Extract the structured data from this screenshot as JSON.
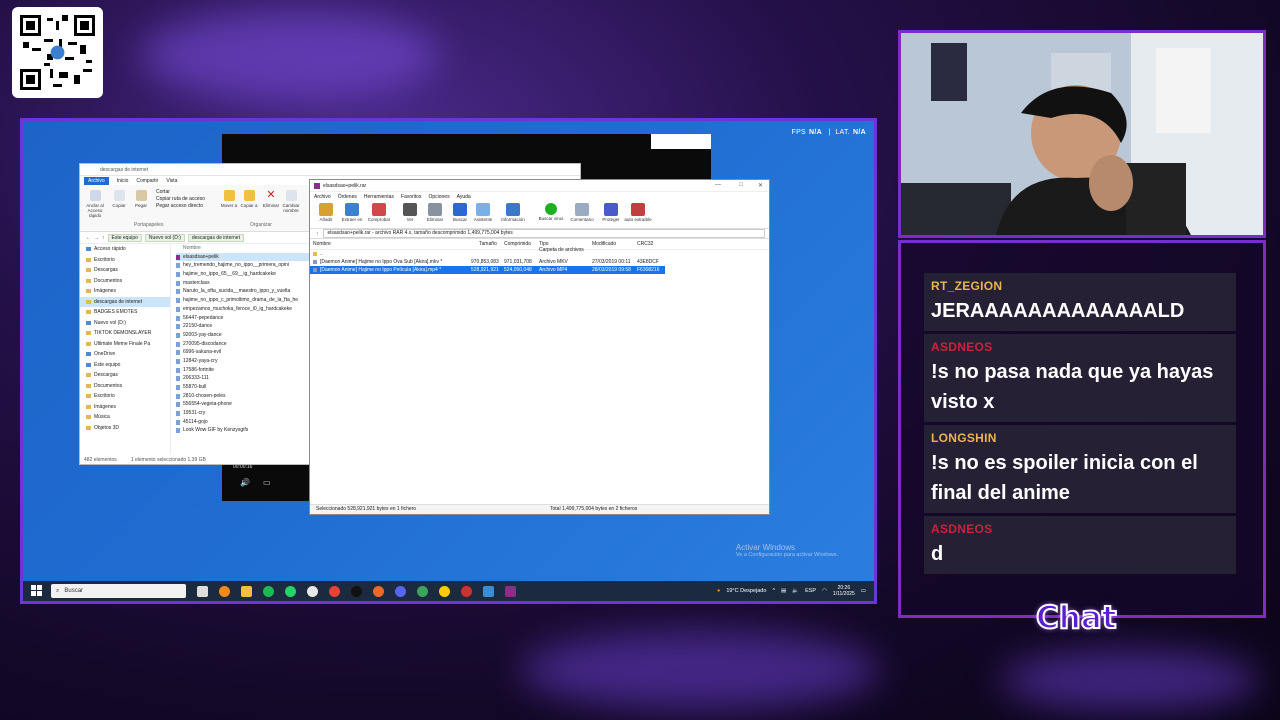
{
  "colors": {
    "accent": "#7a2ec8",
    "selection": "#1a73e8",
    "username_1": "#e8b64a",
    "username_2": "#c8243c"
  },
  "overlay": {
    "fps": {
      "label": "FPS",
      "value": "N/A"
    },
    "lat": {
      "label": "LAT.",
      "value": "N/A"
    },
    "chat_label": "Chat"
  },
  "explorer": {
    "title": "descargas de internet",
    "tabs": [
      "Archivo",
      "Inicio",
      "Compartir",
      "Vista"
    ],
    "ribbon": {
      "pin": "Anclar al Acceso rápido",
      "copy": "Copiar",
      "paste": "Pegar",
      "cut": "Cortar",
      "copy_path": "Copiar ruta de acceso",
      "paste_shortcut": "Pegar acceso directo",
      "move": "Mover a",
      "copy_to": "Copiar a",
      "delete": "Eliminar",
      "rename": "Cambiar nombre",
      "group_clipboard": "Portapapeles",
      "group_organize": "Organizar"
    },
    "address": [
      "Este equipo",
      "Nuevo vol (D:)",
      "descargas de internet"
    ],
    "column_name": "Nombre",
    "nav": [
      {
        "label": "Acceso rápido",
        "icon": "star-icon"
      },
      {
        "label": "Escritorio",
        "icon": "folder-icon"
      },
      {
        "label": "Descargas",
        "icon": "folder-icon"
      },
      {
        "label": "Documentos",
        "icon": "folder-icon"
      },
      {
        "label": "Imágenes",
        "icon": "folder-icon"
      },
      {
        "label": "descargas de internet",
        "icon": "folder-icon"
      },
      {
        "label": "BADGES EMOTES",
        "icon": "folder-icon"
      },
      {
        "label": "Nuevo vol (D:)",
        "icon": "drive-icon"
      },
      {
        "label": "TIKTOK DEMONSLAYER",
        "icon": "folder-icon"
      },
      {
        "label": "Ultimate Meme Finale Pa",
        "icon": "folder-icon"
      },
      {
        "label": "OneDrive",
        "icon": "cloud-icon"
      },
      {
        "label": "Este equipo",
        "icon": "pc-icon"
      },
      {
        "label": "Descargas",
        "icon": "folder-icon"
      },
      {
        "label": "Documentos",
        "icon": "folder-icon"
      },
      {
        "label": "Escritorio",
        "icon": "folder-icon"
      },
      {
        "label": "Imágenes",
        "icon": "folder-icon"
      },
      {
        "label": "Música",
        "icon": "folder-icon"
      },
      {
        "label": "Objetos 3D",
        "icon": "folder-icon"
      }
    ],
    "files": [
      "elsasdsao+pelik",
      "hey_tremendo_hajime_no_ippo__primera_opini",
      "hajime_no_ippo_65__69__ig_hardcakeke",
      "masterclass",
      "Naruto_la_ofta_sucida__maestro_ippo_y_vuelta",
      "hajime_no_ippo_c_primoltimo_drama_de_la_fta_he",
      "empezamos_muchoka_feroce_i0_ig_hardcakeke",
      "56447-pepedance",
      "22150-dance",
      "92003-yay-dance",
      "270095-discodance",
      "6996-sakuna-evil",
      "12842-yaya-cry",
      "17586-fortnite",
      "206333-111",
      "55870-bull",
      "2810-chosen-peles",
      "556554-vegeta-phone",
      "19531-cry",
      "45114-gojo",
      "Look Wow GIF by Kenzysgifs"
    ],
    "status": [
      "482 elementos",
      "1 elemento seleccionado 1,39 GB"
    ]
  },
  "winrar": {
    "title": "elsasdsao+pelik.rar",
    "menu": [
      "Archivo",
      "Órdenes",
      "Herramientas",
      "Favoritos",
      "Opciones",
      "Ayuda"
    ],
    "toolbar": [
      "Añadir",
      "Extraer en",
      "Comprobar",
      "Ver",
      "Eliminar",
      "Buscar",
      "Asistente",
      "Información",
      "Buscar virus",
      "Comentario",
      "Proteger",
      "auto extraíble"
    ],
    "path": "elsasdsao+pelik.rar - archivo RAR 4.x, tamaño descomprimido 1,499,775,004 bytes",
    "columns": [
      "Nombre",
      "Tamaño",
      "Comprimido",
      "Tipo",
      "Modificado",
      "CRC32"
    ],
    "rows": [
      {
        "name": "..",
        "size": "",
        "packed": "",
        "type": "Carpeta de archivos",
        "modified": "",
        "crc": ""
      },
      {
        "name": "[Daemon Anime] Hajime no Ippo Ova Sub [Akira].mkv *",
        "size": "970,853,083",
        "packed": "971,031,708",
        "type": "Archivo MKV",
        "modified": "27/03/2019 00:11",
        "crc": "43E8DCF"
      },
      {
        "name": "[Daemon Anime] Hajime no Ippo Película [Akira].mp4 *",
        "size": "528,921,921",
        "packed": "524,050,048",
        "type": "Archivo MP4",
        "modified": "28/03/2019 09:58",
        "crc": "F6308216"
      }
    ],
    "status_left": "Seleccionado 528,921,921 bytes en 1 fichero",
    "status_right": "Total 1,499,775,004 bytes en 2 ficheros"
  },
  "video": {
    "time": "00:00:16"
  },
  "taskbar": {
    "search": "Buscar",
    "weather": "19°C  Despejado",
    "lang": "ESP",
    "time": "20:26",
    "date": "1/11/2025"
  },
  "watermark": {
    "line1": "Activar Windows",
    "line2": "Ve a Configuración para activar Windows."
  },
  "chat": [
    {
      "user": "RT_ZEGION",
      "text": "JERAAAAAAAAAAAAALD",
      "color": "#e8b64a"
    },
    {
      "user": "ASDNEOS",
      "text": "!s no pasa nada que ya hayas visto x",
      "color": "#c8243c"
    },
    {
      "user": "LONGSHIN",
      "text": "!s no es spoiler inicia con el final del anime",
      "color": "#e8b64a"
    },
    {
      "user": "ASDNEOS",
      "text": "d",
      "color": "#c8243c"
    }
  ]
}
